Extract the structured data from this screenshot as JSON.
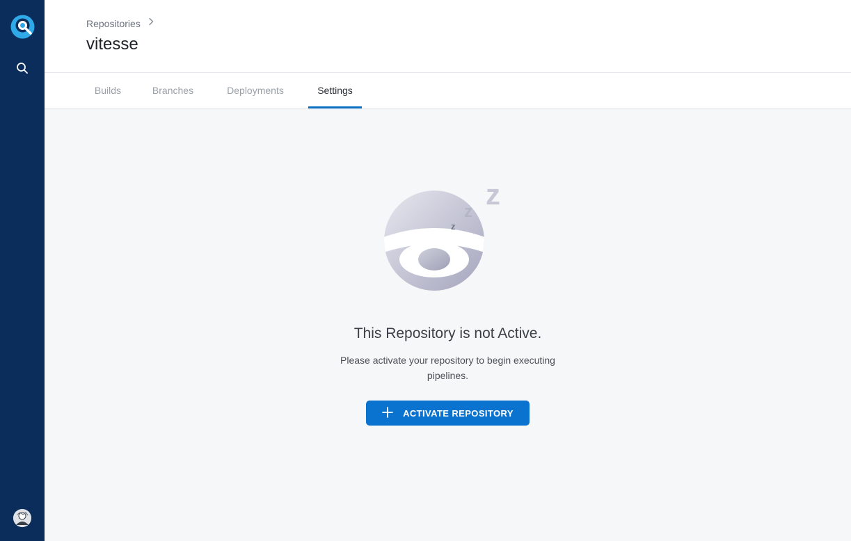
{
  "sidebar": {
    "logo_icon": "drone-logo-icon",
    "search_icon": "search-icon",
    "avatar_icon": "user-avatar"
  },
  "header": {
    "breadcrumb": "Repositories",
    "title": "vitesse"
  },
  "tabs": [
    {
      "label": "Builds",
      "active": false
    },
    {
      "label": "Branches",
      "active": false
    },
    {
      "label": "Deployments",
      "active": false
    },
    {
      "label": "Settings",
      "active": true
    }
  ],
  "empty_state": {
    "illustration_icon": "sleeping-drone-icon",
    "title": "This Repository is not Active.",
    "description": "Please activate your repository to begin executing pipelines.",
    "button_label": "ACTIVATE REPOSITORY",
    "button_icon": "plus-icon"
  },
  "colors": {
    "sidebar": "#0b2d5c",
    "accent": "#0a73cf",
    "active_tab_underline": "#0a6ec2",
    "background": "#f6f7f9"
  }
}
